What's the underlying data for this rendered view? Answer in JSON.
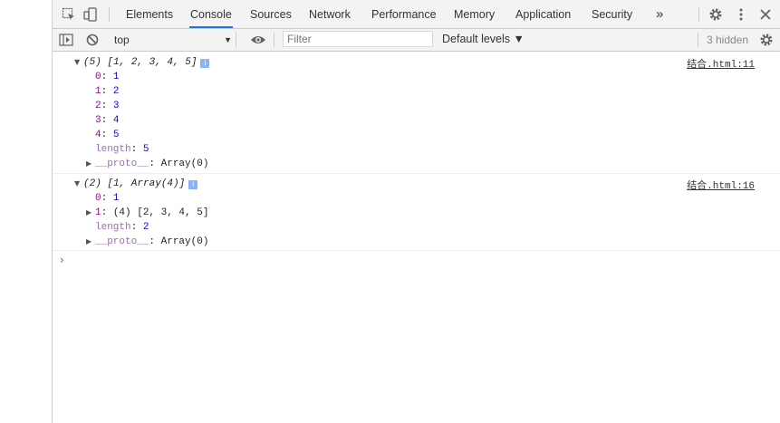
{
  "tabs": [
    "Elements",
    "Console",
    "Sources",
    "Network",
    "Performance",
    "Memory",
    "Application",
    "Security"
  ],
  "more_tabs": "»",
  "toolbar": {
    "context": "top",
    "filter_placeholder": "Filter",
    "levels": "Default levels ▼",
    "hidden": "3 hidden"
  },
  "logs": [
    {
      "source": "结合.html:11",
      "summary": "(5) [1, 2, 3, 4, 5]",
      "entries": [
        {
          "k": "0",
          "v": "1"
        },
        {
          "k": "1",
          "v": "2"
        },
        {
          "k": "2",
          "v": "3"
        },
        {
          "k": "3",
          "v": "4"
        },
        {
          "k": "4",
          "v": "5"
        }
      ],
      "length_key": "length",
      "length": "5",
      "proto_key": "__proto__",
      "proto": "Array(0)"
    },
    {
      "source": "结合.html:16",
      "summary": "(2) [1, Array(4)]",
      "entries": [
        {
          "k": "0",
          "v": "1"
        }
      ],
      "nested_key": "1",
      "nested_value": "(4) [2, 3, 4, 5]",
      "length_key": "length",
      "length": "2",
      "proto_key": "__proto__",
      "proto": "Array(0)"
    }
  ],
  "colors": {
    "accent": "#1a73e8",
    "number": "#1c00cf",
    "key": "#881280"
  },
  "icons": [
    "inspect-icon",
    "device-toolbar-icon",
    "settings-icon",
    "kebab-menu-icon",
    "close-icon",
    "sidebar-toggle-icon",
    "clear-console-icon",
    "eye-icon",
    "info-icon",
    "prompt-chevron-icon"
  ]
}
